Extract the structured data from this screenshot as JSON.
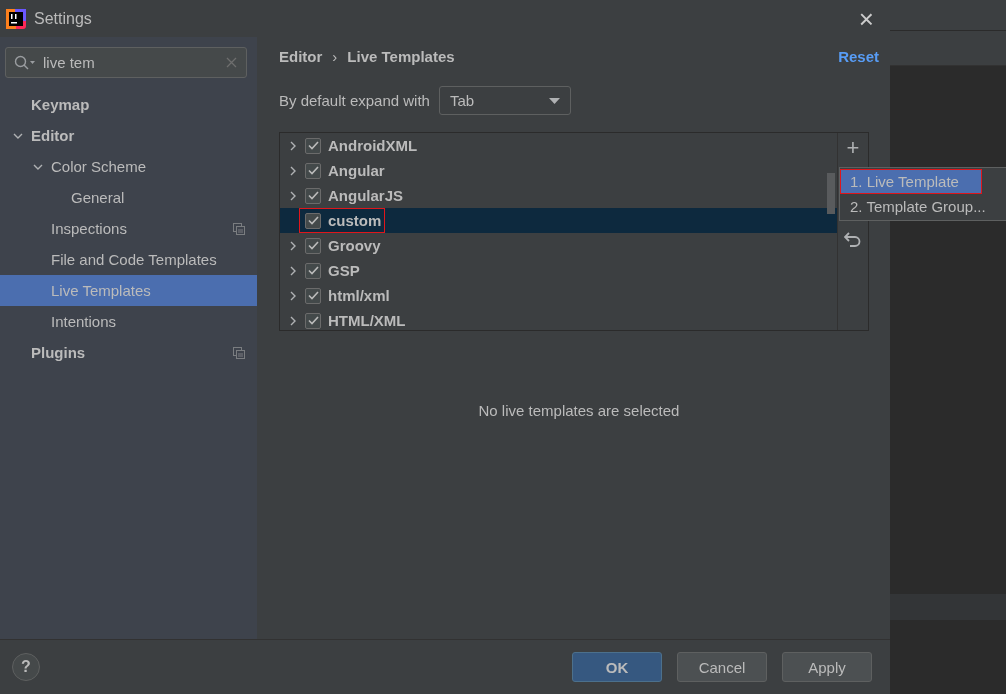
{
  "window": {
    "title": "Settings",
    "close": "×"
  },
  "search": {
    "value": "live tem"
  },
  "sidebar": {
    "items": [
      {
        "label": "Keymap",
        "selected": false,
        "project_icon": false
      },
      {
        "label": "Editor",
        "selected": false,
        "expanded": true,
        "project_icon": false,
        "children": [
          {
            "label": "Color Scheme",
            "selected": false,
            "expanded": true,
            "project_icon": false,
            "children": [
              {
                "label": "General",
                "selected": false,
                "project_icon": false
              }
            ]
          },
          {
            "label": "Inspections",
            "selected": false,
            "project_icon": true
          },
          {
            "label": "File and Code Templates",
            "selected": false,
            "project_icon": false
          },
          {
            "label": "Live Templates",
            "selected": true,
            "project_icon": false
          },
          {
            "label": "Intentions",
            "selected": false,
            "project_icon": false
          }
        ]
      },
      {
        "label": "Plugins",
        "selected": false,
        "project_icon": true
      }
    ]
  },
  "breadcrumb": [
    "Editor",
    "Live Templates"
  ],
  "breadcrumb_separator": "›",
  "reset": "Reset",
  "expand_with": {
    "label": "By default expand with",
    "value": "Tab"
  },
  "groups": [
    {
      "label": "AndroidXML",
      "checked": true,
      "has_children": true,
      "selected": false,
      "highlighted": false
    },
    {
      "label": "Angular",
      "checked": true,
      "has_children": true,
      "selected": false,
      "highlighted": false
    },
    {
      "label": "AngularJS",
      "checked": true,
      "has_children": true,
      "selected": false,
      "highlighted": false
    },
    {
      "label": "custom",
      "checked": true,
      "has_children": false,
      "selected": true,
      "highlighted": true
    },
    {
      "label": "Groovy",
      "checked": true,
      "has_children": true,
      "selected": false,
      "highlighted": false
    },
    {
      "label": "GSP",
      "checked": true,
      "has_children": true,
      "selected": false,
      "highlighted": false
    },
    {
      "label": "html/xml",
      "checked": true,
      "has_children": true,
      "selected": false,
      "highlighted": false
    },
    {
      "label": "HTML/XML",
      "checked": true,
      "has_children": true,
      "selected": false,
      "highlighted": false
    }
  ],
  "toolbar": {
    "add": "+"
  },
  "add_menu": [
    {
      "label": "1. Live Template",
      "selected": true,
      "highlighted": true
    },
    {
      "label": "2. Template Group...",
      "selected": false,
      "highlighted": false
    }
  ],
  "empty_message": "No live templates are selected",
  "help": "?",
  "buttons": [
    {
      "label": "OK",
      "default": true
    },
    {
      "label": "Cancel",
      "default": false
    },
    {
      "label": "Apply",
      "default": false
    }
  ]
}
